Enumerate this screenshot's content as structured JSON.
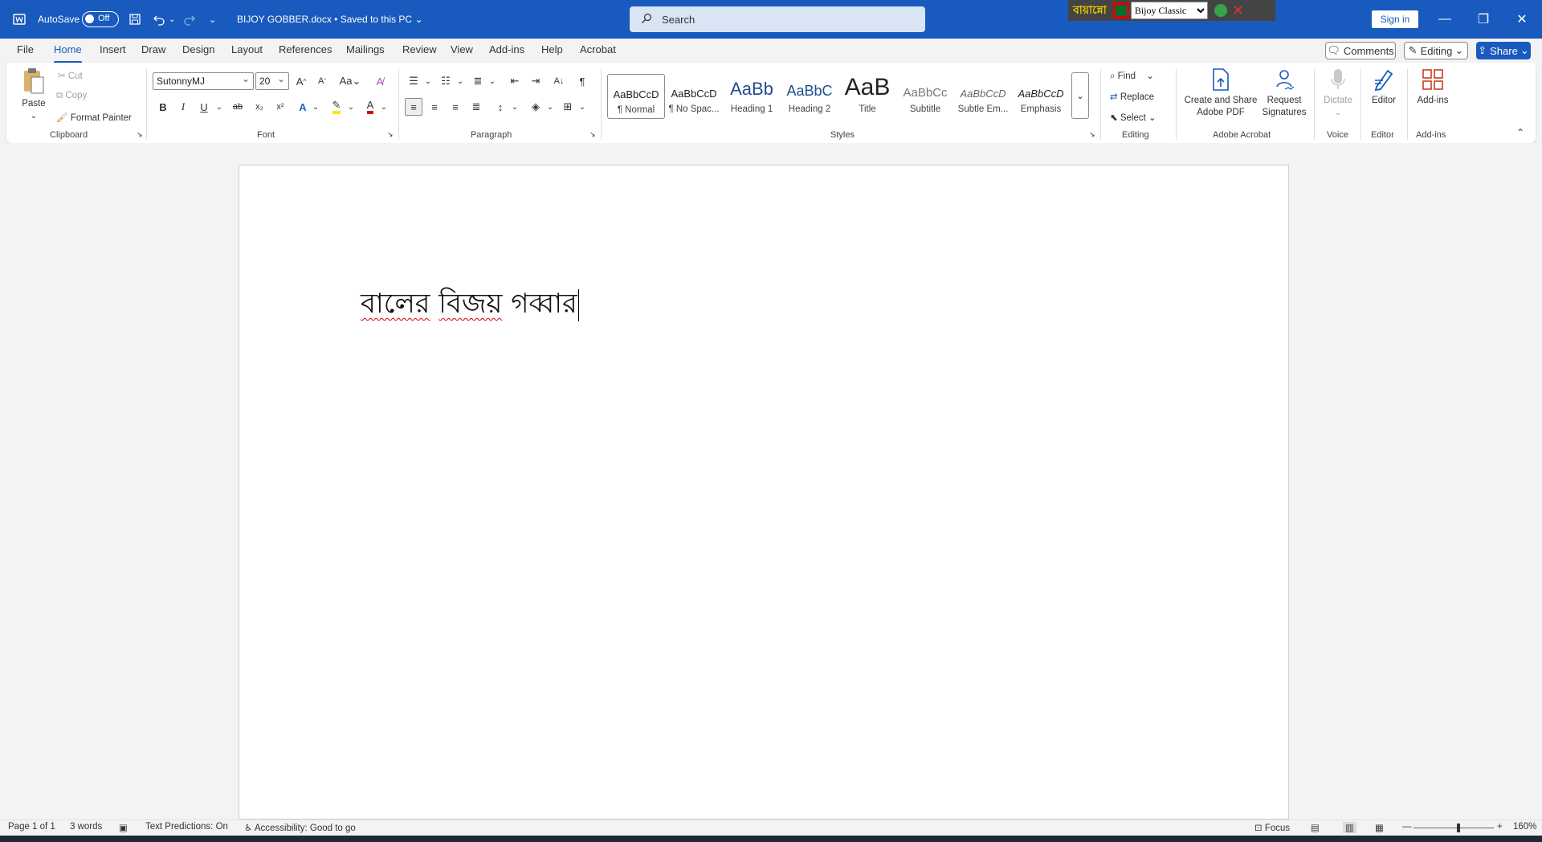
{
  "titlebar": {
    "autosave_label": "AutoSave",
    "autosave_state": "Off",
    "doc_title": "BIJOY GOBBER.docx",
    "save_status": "• Saved to this PC",
    "search_placeholder": "Search",
    "signin": "Sign in"
  },
  "bijoy": {
    "logo": "বায়ান্নো",
    "font_select": "Bijoy Classic"
  },
  "menu": {
    "file": "File",
    "home": "Home",
    "insert": "Insert",
    "draw": "Draw",
    "design": "Design",
    "layout": "Layout",
    "references": "References",
    "mailings": "Mailings",
    "review": "Review",
    "view": "View",
    "addins": "Add-ins",
    "help": "Help",
    "acrobat": "Acrobat",
    "comments": "Comments",
    "editing": "Editing",
    "share": "Share"
  },
  "ribbon": {
    "clipboard": {
      "paste": "Paste",
      "cut": "Cut",
      "copy": "Copy",
      "format_painter": "Format Painter",
      "label": "Clipboard"
    },
    "font": {
      "name": "SutonnyMJ",
      "size": "20",
      "label": "Font"
    },
    "paragraph": {
      "label": "Paragraph"
    },
    "styles": {
      "label": "Styles",
      "items": [
        {
          "sample": "AaBbCcD",
          "name": "¶ Normal"
        },
        {
          "sample": "AaBbCcD",
          "name": "¶ No Spac..."
        },
        {
          "sample": "AaBb",
          "name": "Heading 1"
        },
        {
          "sample": "AaBbC",
          "name": "Heading 2"
        },
        {
          "sample": "AaB",
          "name": "Title"
        },
        {
          "sample": "AaBbCc",
          "name": "Subtitle"
        },
        {
          "sample": "AaBbCcD",
          "name": "Subtle Em..."
        },
        {
          "sample": "AaBbCcD",
          "name": "Emphasis"
        }
      ]
    },
    "editing": {
      "find": "Find",
      "replace": "Replace",
      "select": "Select",
      "label": "Editing"
    },
    "acrobat": {
      "create_line1": "Create and Share",
      "create_line2": "Adobe PDF",
      "request_line1": "Request",
      "request_line2": "Signatures",
      "label": "Adobe Acrobat"
    },
    "voice": {
      "dictate": "Dictate",
      "label": "Voice"
    },
    "editor": {
      "btn": "Editor",
      "label": "Editor"
    },
    "addins": {
      "btn": "Add-ins",
      "label": "Add-ins"
    }
  },
  "document": {
    "words": [
      "বালের",
      "বিজয়",
      "গব্বার"
    ]
  },
  "statusbar": {
    "page": "Page 1 of 1",
    "words": "3 words",
    "predictions": "Text Predictions: On",
    "accessibility": "Accessibility: Good to go",
    "focus": "Focus",
    "zoom": "160%"
  },
  "colors": {
    "accent": "#185abd",
    "title_bg": "#185abd",
    "highlight": "#ffe600",
    "font_color": "#e00000"
  }
}
